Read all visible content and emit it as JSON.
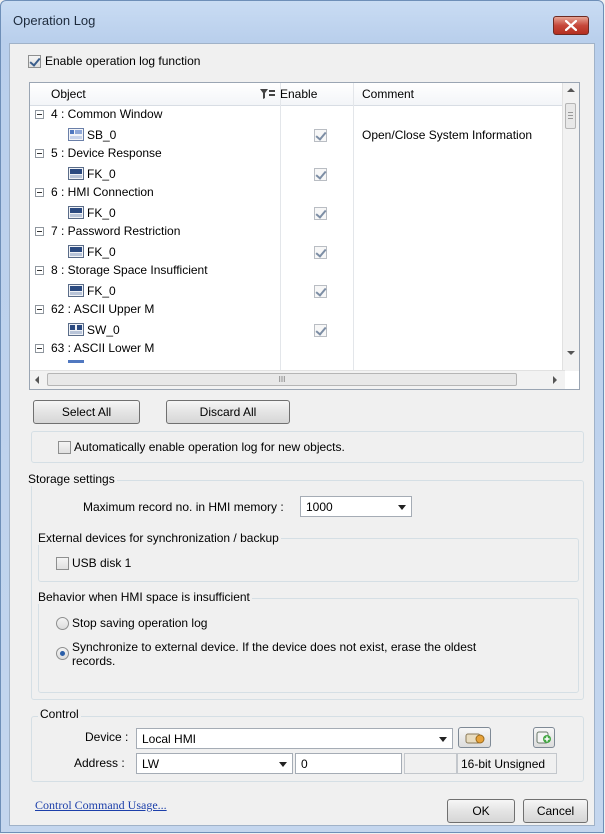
{
  "window": {
    "title": "Operation Log"
  },
  "enable_log": {
    "label": "Enable operation log function",
    "checked": true
  },
  "table": {
    "columns": [
      "Object",
      "Enable",
      "Comment"
    ],
    "filter_icon": "filter-icon",
    "rows": [
      {
        "type": "group",
        "label": "4 : Common Window"
      },
      {
        "type": "item",
        "icon": "system-button-icon",
        "name": "SB_0",
        "enabled": true,
        "comment": "Open/Close System Information"
      },
      {
        "type": "group",
        "label": "5 : Device Response"
      },
      {
        "type": "item",
        "icon": "function-key-icon",
        "name": "FK_0",
        "enabled": true,
        "comment": ""
      },
      {
        "type": "group",
        "label": "6 : HMI Connection"
      },
      {
        "type": "item",
        "icon": "function-key-icon",
        "name": "FK_0",
        "enabled": true,
        "comment": ""
      },
      {
        "type": "group",
        "label": "7 : Password Restriction"
      },
      {
        "type": "item",
        "icon": "function-key-icon",
        "name": "FK_0",
        "enabled": true,
        "comment": ""
      },
      {
        "type": "group",
        "label": "8 : Storage Space Insufficient"
      },
      {
        "type": "item",
        "icon": "function-key-icon",
        "name": "FK_0",
        "enabled": true,
        "comment": ""
      },
      {
        "type": "group",
        "label": "62 : ASCII Upper M"
      },
      {
        "type": "item",
        "icon": "switch-icon",
        "name": "SW_0",
        "enabled": true,
        "comment": ""
      },
      {
        "type": "group",
        "label": "63 : ASCII Lower M"
      }
    ],
    "hscroll_grip": "III"
  },
  "buttons": {
    "select_all": "Select All",
    "discard_all": "Discard All",
    "ok": "OK",
    "cancel": "Cancel"
  },
  "auto_enable": {
    "label": "Automatically enable operation log for new objects.",
    "checked": false
  },
  "storage": {
    "legend": "Storage settings",
    "max_record_label": "Maximum record no. in HMI memory :",
    "max_record_value": "1000",
    "external_legend": "External devices for synchronization / backup",
    "usb_label": "USB disk 1",
    "usb_checked": false,
    "behavior_legend": "Behavior when HMI space is insufficient",
    "option_stop": "Stop saving operation log",
    "option_sync_line1": "Synchronize to external device. If the device does not exist, erase the oldest",
    "option_sync_line2": "records.",
    "selected_option": "sync"
  },
  "control": {
    "legend": "Control",
    "device_label": "Device :",
    "device_value": "Local HMI",
    "address_label": "Address :",
    "address_type": "LW",
    "address_value": "0",
    "address_format": "16-bit Unsigned"
  },
  "footer": {
    "link": "Control Command Usage..."
  },
  "colors": {
    "title_bar": "#c9dcf3",
    "close_button": "#c6483b",
    "link": "#1c3faa"
  }
}
